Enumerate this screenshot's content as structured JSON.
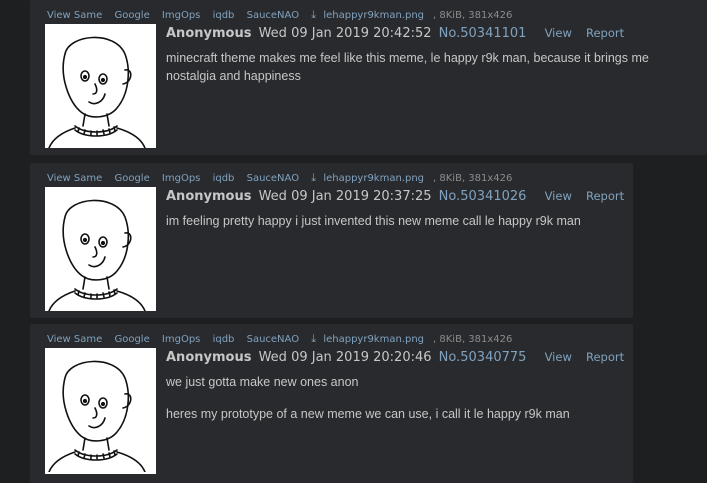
{
  "file_links": [
    "View Same",
    "Google",
    "ImgOps",
    "iqdb",
    "SauceNAO"
  ],
  "posts": [
    {
      "filename": "lehappyr9kman.png",
      "fileinfo": ", 8KiB, 381x426",
      "name": "Anonymous",
      "date": "Wed 09 Jan 2019 20:42:52",
      "number": "No.50341101",
      "view": "View",
      "report": "Report",
      "message": [
        "minecraft theme makes me feel like this meme, le happy r9k man, because it brings me nostalgia and happiness"
      ]
    },
    {
      "filename": "lehappyr9kman.png",
      "fileinfo": ", 8KiB, 381x426",
      "name": "Anonymous",
      "date": "Wed 09 Jan 2019 20:37:25",
      "number": "No.50341026",
      "view": "View",
      "report": "Report",
      "message": [
        "im feeling pretty happy i just invented this new meme call le happy r9k man"
      ]
    },
    {
      "filename": "lehappyr9kman.png",
      "fileinfo": ", 8KiB, 381x426",
      "name": "Anonymous",
      "date": "Wed 09 Jan 2019 20:20:46",
      "number": "No.50340775",
      "view": "View",
      "report": "Report",
      "message": [
        "we just gotta make new ones anon",
        "heres my prototype of a new meme we can use, i call it le happy r9k man"
      ]
    }
  ],
  "icons": {
    "download": "download-icon"
  },
  "colors": {
    "background": "#1d1f21",
    "post": "#282a2e",
    "link": "#81a2be",
    "text": "#c5c8c6"
  }
}
